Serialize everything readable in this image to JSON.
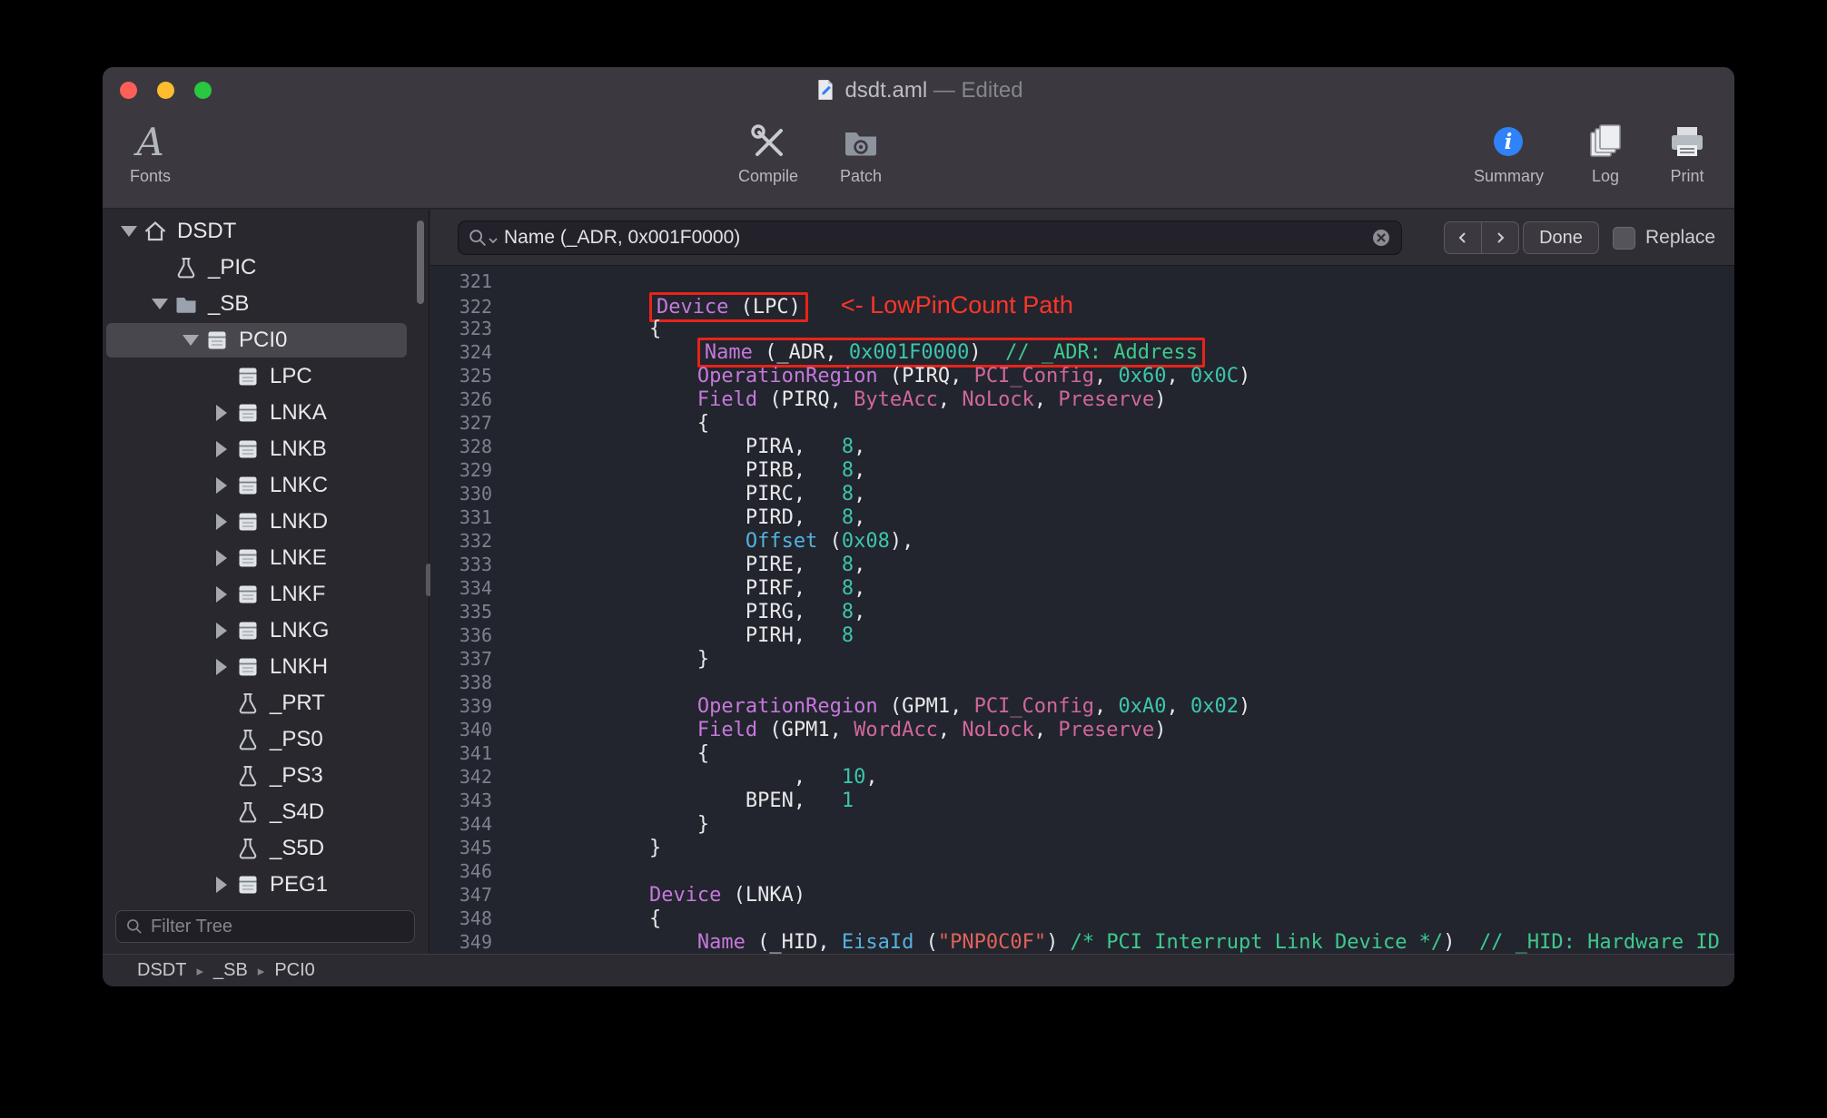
{
  "window": {
    "title": {
      "filename": "dsdt.aml",
      "status": " — Edited"
    }
  },
  "toolbar": {
    "left": [
      {
        "label": "Fonts",
        "icon": "fonts"
      }
    ],
    "center": [
      {
        "label": "Compile",
        "icon": "compile"
      },
      {
        "label": "Patch",
        "icon": "patch"
      }
    ],
    "right": [
      {
        "label": "Summary",
        "icon": "summary"
      },
      {
        "label": "Log",
        "icon": "log"
      },
      {
        "label": "Print",
        "icon": "print"
      }
    ]
  },
  "findbar": {
    "query": "Name (_ADR, 0x001F0000)",
    "done_label": "Done",
    "replace_label": "Replace",
    "replace_checked": false
  },
  "sidebar": {
    "filter_placeholder": "Filter Tree",
    "items": [
      {
        "label": "DSDT",
        "icon": "house",
        "disclosure": "open",
        "indent": 0,
        "selected": false
      },
      {
        "label": "_PIC",
        "icon": "method",
        "disclosure": "none",
        "indent": 1,
        "selected": false
      },
      {
        "label": "_SB",
        "icon": "folder",
        "disclosure": "open",
        "indent": 1,
        "selected": false
      },
      {
        "label": "PCI0",
        "icon": "device",
        "disclosure": "open",
        "indent": 2,
        "selected": true
      },
      {
        "label": "LPC",
        "icon": "device",
        "disclosure": "none",
        "indent": 3,
        "selected": false
      },
      {
        "label": "LNKA",
        "icon": "device",
        "disclosure": "closed",
        "indent": 3,
        "selected": false
      },
      {
        "label": "LNKB",
        "icon": "device",
        "disclosure": "closed",
        "indent": 3,
        "selected": false
      },
      {
        "label": "LNKC",
        "icon": "device",
        "disclosure": "closed",
        "indent": 3,
        "selected": false
      },
      {
        "label": "LNKD",
        "icon": "device",
        "disclosure": "closed",
        "indent": 3,
        "selected": false
      },
      {
        "label": "LNKE",
        "icon": "device",
        "disclosure": "closed",
        "indent": 3,
        "selected": false
      },
      {
        "label": "LNKF",
        "icon": "device",
        "disclosure": "closed",
        "indent": 3,
        "selected": false
      },
      {
        "label": "LNKG",
        "icon": "device",
        "disclosure": "closed",
        "indent": 3,
        "selected": false
      },
      {
        "label": "LNKH",
        "icon": "device",
        "disclosure": "closed",
        "indent": 3,
        "selected": false
      },
      {
        "label": "_PRT",
        "icon": "method",
        "disclosure": "none",
        "indent": 3,
        "selected": false
      },
      {
        "label": "_PS0",
        "icon": "method",
        "disclosure": "none",
        "indent": 3,
        "selected": false
      },
      {
        "label": "_PS3",
        "icon": "method",
        "disclosure": "none",
        "indent": 3,
        "selected": false
      },
      {
        "label": "_S4D",
        "icon": "method",
        "disclosure": "none",
        "indent": 3,
        "selected": false
      },
      {
        "label": "_S5D",
        "icon": "method",
        "disclosure": "none",
        "indent": 3,
        "selected": false
      },
      {
        "label": "PEG1",
        "icon": "device",
        "disclosure": "closed",
        "indent": 3,
        "selected": false
      }
    ]
  },
  "breadcrumb": {
    "items": [
      "DSDT",
      "_SB",
      "PCI0"
    ]
  },
  "annotation": {
    "text": "<- LowPinCount Path"
  },
  "colors": {
    "annotation_red": "#e8231a",
    "keyword_purple": "#c678dd",
    "number_teal": "#3cc5ae",
    "constant_pink": "#d1679c",
    "function_blue": "#55b1de",
    "string_red": "#e0635a",
    "comment_green": "#3ec98f",
    "summary_blue": "#2f82f7"
  },
  "editor": {
    "lines": [
      {
        "num": 321,
        "segments": []
      },
      {
        "num": 322,
        "segments": [
          {
            "t": "            "
          },
          {
            "t": "Device",
            "c": "kw",
            "box": true
          },
          {
            "t": " (LPC)",
            "box": true
          },
          {
            "t": "<- LowPinCount Path",
            "c": "annot"
          }
        ]
      },
      {
        "num": 323,
        "segments": [
          {
            "t": "            {"
          }
        ]
      },
      {
        "num": 324,
        "segments": [
          {
            "t": "                "
          },
          {
            "t": "Name",
            "c": "kw",
            "box": true
          },
          {
            "t": " (_ADR, ",
            "box": true
          },
          {
            "t": "0x001F0000",
            "c": "num",
            "box": true
          },
          {
            "t": ")  ",
            "box": true
          },
          {
            "t": "// _ADR: Address",
            "c": "com",
            "box": true
          }
        ]
      },
      {
        "num": 325,
        "segments": [
          {
            "t": "                "
          },
          {
            "t": "OperationRegion",
            "c": "kw"
          },
          {
            "t": " (PIRQ, "
          },
          {
            "t": "PCI_Config",
            "c": "const"
          },
          {
            "t": ", "
          },
          {
            "t": "0x60",
            "c": "num"
          },
          {
            "t": ", "
          },
          {
            "t": "0x0C",
            "c": "num"
          },
          {
            "t": ")"
          }
        ]
      },
      {
        "num": 326,
        "segments": [
          {
            "t": "                "
          },
          {
            "t": "Field",
            "c": "kw"
          },
          {
            "t": " (PIRQ, "
          },
          {
            "t": "ByteAcc",
            "c": "const"
          },
          {
            "t": ", "
          },
          {
            "t": "NoLock",
            "c": "const"
          },
          {
            "t": ", "
          },
          {
            "t": "Preserve",
            "c": "const"
          },
          {
            "t": ")"
          }
        ]
      },
      {
        "num": 327,
        "segments": [
          {
            "t": "                {"
          }
        ]
      },
      {
        "num": 328,
        "segments": [
          {
            "t": "                    PIRA,   "
          },
          {
            "t": "8",
            "c": "num"
          },
          {
            "t": ","
          }
        ]
      },
      {
        "num": 329,
        "segments": [
          {
            "t": "                    PIRB,   "
          },
          {
            "t": "8",
            "c": "num"
          },
          {
            "t": ","
          }
        ]
      },
      {
        "num": 330,
        "segments": [
          {
            "t": "                    PIRC,   "
          },
          {
            "t": "8",
            "c": "num"
          },
          {
            "t": ","
          }
        ]
      },
      {
        "num": 331,
        "segments": [
          {
            "t": "                    PIRD,   "
          },
          {
            "t": "8",
            "c": "num"
          },
          {
            "t": ","
          }
        ]
      },
      {
        "num": 332,
        "segments": [
          {
            "t": "                    "
          },
          {
            "t": "Offset",
            "c": "fn"
          },
          {
            "t": " ("
          },
          {
            "t": "0x08",
            "c": "num"
          },
          {
            "t": "),"
          }
        ]
      },
      {
        "num": 333,
        "segments": [
          {
            "t": "                    PIRE,   "
          },
          {
            "t": "8",
            "c": "num"
          },
          {
            "t": ","
          }
        ]
      },
      {
        "num": 334,
        "segments": [
          {
            "t": "                    PIRF,   "
          },
          {
            "t": "8",
            "c": "num"
          },
          {
            "t": ","
          }
        ]
      },
      {
        "num": 335,
        "segments": [
          {
            "t": "                    PIRG,   "
          },
          {
            "t": "8",
            "c": "num"
          },
          {
            "t": ","
          }
        ]
      },
      {
        "num": 336,
        "segments": [
          {
            "t": "                    PIRH,   "
          },
          {
            "t": "8",
            "c": "num"
          }
        ]
      },
      {
        "num": 337,
        "segments": [
          {
            "t": "                }"
          }
        ]
      },
      {
        "num": 338,
        "segments": []
      },
      {
        "num": 339,
        "segments": [
          {
            "t": "                "
          },
          {
            "t": "OperationRegion",
            "c": "kw"
          },
          {
            "t": " (GPM1, "
          },
          {
            "t": "PCI_Config",
            "c": "const"
          },
          {
            "t": ", "
          },
          {
            "t": "0xA0",
            "c": "num"
          },
          {
            "t": ", "
          },
          {
            "t": "0x02",
            "c": "num"
          },
          {
            "t": ")"
          }
        ]
      },
      {
        "num": 340,
        "segments": [
          {
            "t": "                "
          },
          {
            "t": "Field",
            "c": "kw"
          },
          {
            "t": " (GPM1, "
          },
          {
            "t": "WordAcc",
            "c": "const"
          },
          {
            "t": ", "
          },
          {
            "t": "NoLock",
            "c": "const"
          },
          {
            "t": ", "
          },
          {
            "t": "Preserve",
            "c": "const"
          },
          {
            "t": ")"
          }
        ]
      },
      {
        "num": 341,
        "segments": [
          {
            "t": "                {"
          }
        ]
      },
      {
        "num": 342,
        "segments": [
          {
            "t": "                        ,   "
          },
          {
            "t": "10",
            "c": "num"
          },
          {
            "t": ","
          }
        ]
      },
      {
        "num": 343,
        "segments": [
          {
            "t": "                    BPEN,   "
          },
          {
            "t": "1",
            "c": "num"
          }
        ]
      },
      {
        "num": 344,
        "segments": [
          {
            "t": "                }"
          }
        ]
      },
      {
        "num": 345,
        "segments": [
          {
            "t": "            }"
          }
        ]
      },
      {
        "num": 346,
        "segments": []
      },
      {
        "num": 347,
        "segments": [
          {
            "t": "            "
          },
          {
            "t": "Device",
            "c": "kw"
          },
          {
            "t": " (LNKA)"
          }
        ]
      },
      {
        "num": 348,
        "segments": [
          {
            "t": "            {"
          }
        ]
      },
      {
        "num": 349,
        "segments": [
          {
            "t": "                "
          },
          {
            "t": "Name",
            "c": "kw"
          },
          {
            "t": " (_HID, "
          },
          {
            "t": "EisaId",
            "c": "fn"
          },
          {
            "t": " ("
          },
          {
            "t": "\"PNP0C0F\"",
            "c": "str"
          },
          {
            "t": ") "
          },
          {
            "t": "/* PCI Interrupt Link Device */",
            "c": "com"
          },
          {
            "t": ")  "
          },
          {
            "t": "// _HID: Hardware ID",
            "c": "com"
          }
        ]
      }
    ]
  }
}
